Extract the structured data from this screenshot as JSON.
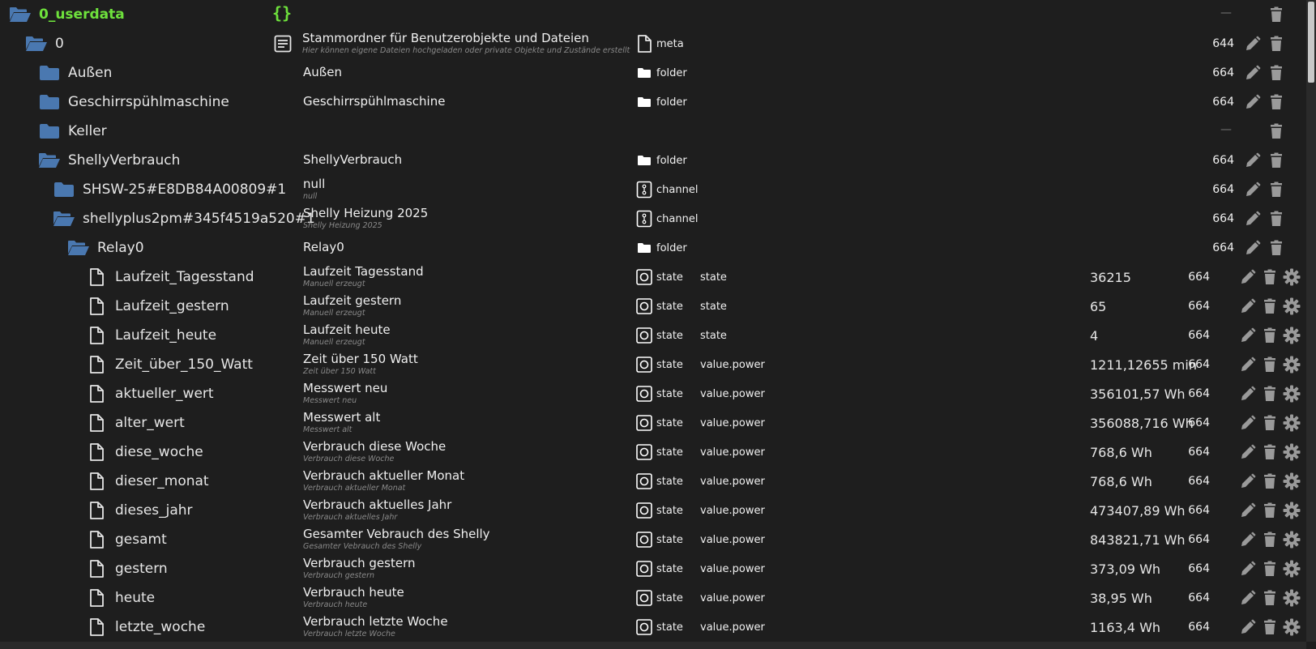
{
  "colors": {
    "folder": "#4a78b0",
    "root_text": "#6ee13c",
    "icon": "#9a9a9a",
    "background": "#1e1e1e"
  },
  "rows": [
    {
      "name": "0_userdata",
      "icon": "folder-open-icon",
      "indent": 0,
      "root": true,
      "desc": "",
      "desc_sub": "",
      "type": "",
      "role": "",
      "value": "",
      "acl": "",
      "dash": true,
      "edit": false,
      "gear": false,
      "json_icon": true
    },
    {
      "name": "0",
      "icon": "folder-open-icon",
      "indent": 1,
      "desc": "Stammordner für Benutzerobjekte und Dateien",
      "desc_sub": "Hier können eigene Dateien hochgeladen oder private Objekte und Zustände erstellt",
      "desc_icon": true,
      "type": "meta",
      "type_icon": "file-icon",
      "role": "",
      "value": "",
      "acl": "644",
      "edit": true,
      "gear": false
    },
    {
      "name": "Außen",
      "icon": "folder-icon",
      "indent": 2,
      "desc": "Außen",
      "desc_sub": "",
      "type": "folder",
      "type_icon": "folder-white-icon",
      "role": "",
      "value": "",
      "acl": "664",
      "edit": true,
      "gear": false
    },
    {
      "name": "Geschirrspühlmaschine",
      "icon": "folder-icon",
      "indent": 2,
      "desc": "Geschirrspühlmaschine",
      "desc_sub": "",
      "type": "folder",
      "type_icon": "folder-white-icon",
      "role": "",
      "value": "",
      "acl": "664",
      "edit": true,
      "gear": false
    },
    {
      "name": "Keller",
      "icon": "folder-icon",
      "indent": 2,
      "desc": "",
      "desc_sub": "",
      "type": "",
      "role": "",
      "value": "",
      "acl": "",
      "dash": true,
      "edit": false,
      "gear": false
    },
    {
      "name": "ShellyVerbrauch",
      "icon": "folder-open-icon",
      "indent": 2,
      "desc": "ShellyVerbrauch",
      "desc_sub": "",
      "type": "folder",
      "type_icon": "folder-white-icon",
      "role": "",
      "value": "",
      "acl": "664",
      "edit": true,
      "gear": false
    },
    {
      "name": "SHSW-25#E8DB84A00809#1",
      "icon": "folder-icon",
      "indent": 3,
      "desc": "null",
      "desc_sub": "null",
      "type": "channel",
      "type_icon": "channel-icon",
      "role": "",
      "value": "",
      "acl": "664",
      "edit": true,
      "gear": false
    },
    {
      "name": "shellyplus2pm#345f4519a520#1",
      "icon": "folder-open-icon",
      "indent": 3,
      "desc": "Shelly Heizung 2025",
      "desc_sub": "Shelly Heizung 2025",
      "type": "channel",
      "type_icon": "channel-icon",
      "role": "",
      "value": "",
      "acl": "664",
      "edit": true,
      "gear": false
    },
    {
      "name": "Relay0",
      "icon": "folder-open-icon",
      "indent": 4,
      "desc": "Relay0",
      "desc_sub": "",
      "type": "folder",
      "type_icon": "folder-white-icon",
      "role": "",
      "value": "",
      "acl": "664",
      "edit": true,
      "gear": false
    },
    {
      "name": "Laufzeit_Tagesstand",
      "icon": "file-icon",
      "indent": 5,
      "desc": "Laufzeit Tagesstand",
      "desc_sub": "Manuell erzeugt",
      "type": "state",
      "type_icon": "state-icon",
      "role": "state",
      "value": "36215",
      "acl": "664",
      "edit": true,
      "gear": true
    },
    {
      "name": "Laufzeit_gestern",
      "icon": "file-icon",
      "indent": 5,
      "desc": "Laufzeit gestern",
      "desc_sub": "Manuell erzeugt",
      "type": "state",
      "type_icon": "state-icon",
      "role": "state",
      "value": "65",
      "acl": "664",
      "edit": true,
      "gear": true
    },
    {
      "name": "Laufzeit_heute",
      "icon": "file-icon",
      "indent": 5,
      "desc": "Laufzeit heute",
      "desc_sub": "Manuell erzeugt",
      "type": "state",
      "type_icon": "state-icon",
      "role": "state",
      "value": "4",
      "acl": "664",
      "edit": true,
      "gear": true
    },
    {
      "name": "Zeit_über_150_Watt",
      "icon": "file-icon",
      "indent": 5,
      "desc": "Zeit über 150 Watt",
      "desc_sub": "Zeit über 150 Watt",
      "type": "state",
      "type_icon": "state-icon",
      "role": "value.power",
      "value": "1211,12655 min",
      "acl": "664",
      "edit": true,
      "gear": true
    },
    {
      "name": "aktueller_wert",
      "icon": "file-icon",
      "indent": 5,
      "desc": "Messwert neu",
      "desc_sub": "Messwert neu",
      "type": "state",
      "type_icon": "state-icon",
      "role": "value.power",
      "value": "356101,57 Wh",
      "acl": "664",
      "edit": true,
      "gear": true
    },
    {
      "name": "alter_wert",
      "icon": "file-icon",
      "indent": 5,
      "desc": "Messwert alt",
      "desc_sub": "Messwert alt",
      "type": "state",
      "type_icon": "state-icon",
      "role": "value.power",
      "value": "356088,716 Wh",
      "acl": "664",
      "edit": true,
      "gear": true
    },
    {
      "name": "diese_woche",
      "icon": "file-icon",
      "indent": 5,
      "desc": "Verbrauch diese Woche",
      "desc_sub": "Verbrauch diese Woche",
      "type": "state",
      "type_icon": "state-icon",
      "role": "value.power",
      "value": "768,6 Wh",
      "acl": "664",
      "edit": true,
      "gear": true
    },
    {
      "name": "dieser_monat",
      "icon": "file-icon",
      "indent": 5,
      "desc": "Verbrauch aktueller Monat",
      "desc_sub": "Verbrauch aktueller Monat",
      "type": "state",
      "type_icon": "state-icon",
      "role": "value.power",
      "value": "768,6 Wh",
      "acl": "664",
      "edit": true,
      "gear": true
    },
    {
      "name": "dieses_jahr",
      "icon": "file-icon",
      "indent": 5,
      "desc": "Verbrauch aktuelles Jahr",
      "desc_sub": "Verbrauch aktuelles Jahr",
      "type": "state",
      "type_icon": "state-icon",
      "role": "value.power",
      "value": "473407,89 Wh",
      "acl": "664",
      "edit": true,
      "gear": true
    },
    {
      "name": "gesamt",
      "icon": "file-icon",
      "indent": 5,
      "desc": "Gesamter Vebrauch des Shelly",
      "desc_sub": "Gesamter Vebrauch des Shelly",
      "type": "state",
      "type_icon": "state-icon",
      "role": "value.power",
      "value": "843821,71 Wh",
      "acl": "664",
      "edit": true,
      "gear": true
    },
    {
      "name": "gestern",
      "icon": "file-icon",
      "indent": 5,
      "desc": "Verbrauch gestern",
      "desc_sub": "Verbrauch gestern",
      "type": "state",
      "type_icon": "state-icon",
      "role": "value.power",
      "value": "373,09 Wh",
      "acl": "664",
      "edit": true,
      "gear": true
    },
    {
      "name": "heute",
      "icon": "file-icon",
      "indent": 5,
      "desc": "Verbrauch heute",
      "desc_sub": "Verbrauch heute",
      "type": "state",
      "type_icon": "state-icon",
      "role": "value.power",
      "value": "38,95 Wh",
      "acl": "664",
      "edit": true,
      "gear": true
    },
    {
      "name": "letzte_woche",
      "icon": "file-icon",
      "indent": 5,
      "desc": "Verbrauch letzte Woche",
      "desc_sub": "Verbrauch letzte Woche",
      "type": "state",
      "type_icon": "state-icon",
      "role": "value.power",
      "value": "1163,4 Wh",
      "acl": "664",
      "edit": true,
      "gear": true
    }
  ]
}
